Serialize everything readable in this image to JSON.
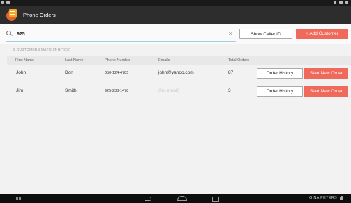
{
  "app": {
    "title": "Phone Orders"
  },
  "search": {
    "value": "925",
    "placeholder": ""
  },
  "actions": {
    "show_caller_id": "Show Caller ID",
    "add_customer": "+ Add Customer"
  },
  "match_label": "2 CUSTOMERS MATCHING \"925\"",
  "table": {
    "columns": [
      "First Name",
      "Last Name",
      "Phone Number",
      "Emails",
      "Total Orders"
    ],
    "rows": [
      {
        "first": "John",
        "last": "Don",
        "phone": "650-124-4785",
        "email": "john@yahoo.com",
        "orders": "87"
      },
      {
        "first": "Jim",
        "last": "Smith",
        "phone": "925-238-1478",
        "email": "(No email)",
        "orders": "3"
      }
    ],
    "order_history_label": "Order History",
    "start_new_order_label": "Start New Order"
  },
  "navbar": {
    "user": "GINA PETERS"
  },
  "colors": {
    "accent": "#ef6a5b",
    "appbar": "#2d2d2d",
    "search_underline": "#9fd1e3"
  }
}
